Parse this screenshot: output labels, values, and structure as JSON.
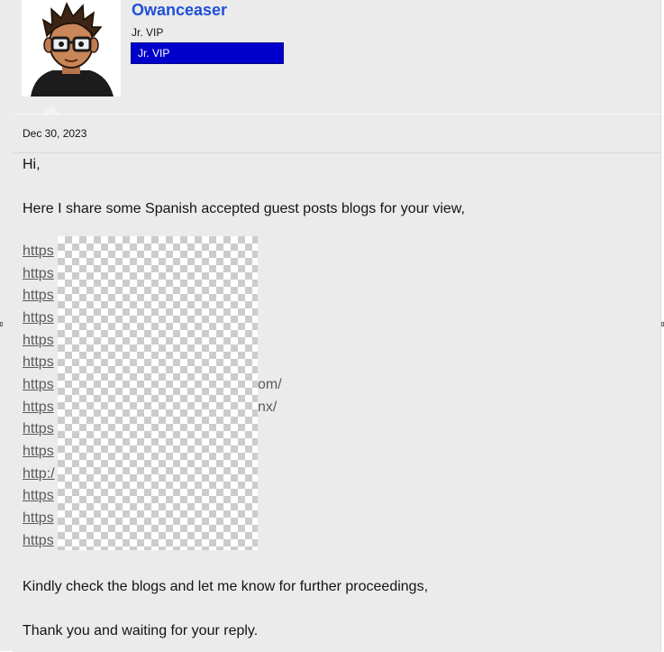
{
  "post": {
    "author": {
      "username": "Owanceaser",
      "user_title": "Jr. VIP",
      "banner": "Jr. VIP",
      "avatar_icon": "cartoon-avatar-icon"
    },
    "date": "Dec 30, 2023",
    "body": {
      "greeting": "Hi,",
      "intro": "Here I share some Spanish accepted guest posts blogs for your view,",
      "links": [
        "https",
        "https",
        "https",
        "https",
        "https",
        "https",
        "https://...om/",
        "https://...nx/",
        "https",
        "https",
        "http:/",
        "https",
        "https",
        "https"
      ],
      "link_visible": [
        "https",
        "https",
        "https",
        "https",
        "https",
        "https",
        "https",
        "https",
        "https",
        "https",
        "http:/",
        "https",
        "https",
        "https"
      ],
      "link_tails": [
        "",
        "",
        "",
        "",
        "",
        "",
        "om/",
        "nx/",
        "",
        "",
        "",
        "",
        "",
        ""
      ],
      "closing": "Kindly check the blogs and let me know for further proceedings,",
      "signoff": "Thank you and waiting for your reply."
    }
  },
  "colors": {
    "username": "#1f4fd8",
    "banner_bg": "#0000cc",
    "post_bg": "#ebebeb",
    "link": "#5a5a5a"
  }
}
